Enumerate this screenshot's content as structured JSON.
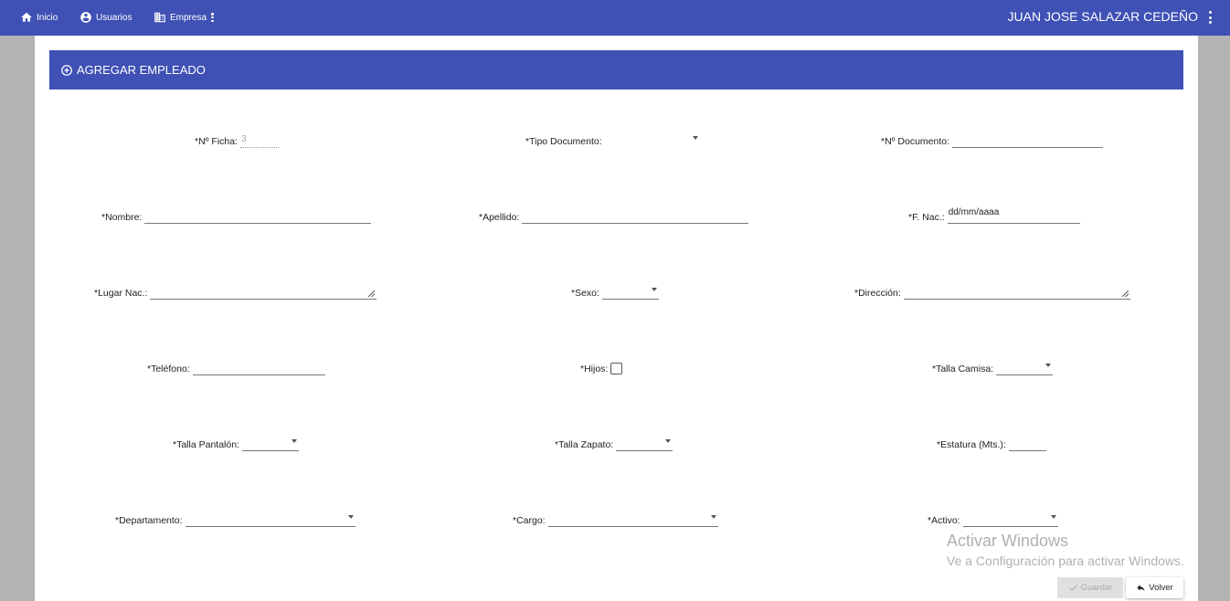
{
  "nav": {
    "home": "Inicio",
    "users": "Usuarios",
    "company": "Empresa",
    "user_name": "JUAN JOSE SALAZAR CEDEÑO"
  },
  "form": {
    "title": "AGREGAR EMPLEADO",
    "fields": {
      "ficha_label": "*Nº Ficha:",
      "ficha_value": "3",
      "tipo_doc_label": "*Tipo Documento:",
      "num_doc_label": "*Nº Documento:",
      "nombre_label": "*Nombre:",
      "apellido_label": "*Apellido:",
      "fnac_label": "*F. Nac.:",
      "fnac_value": "dd/mm/aaaa",
      "lugar_label": "*Lugar Nac.:",
      "sexo_label": "*Sexo:",
      "direccion_label": "*Dirección:",
      "telefono_label": "*Teléfono:",
      "hijos_label": "*Hijos:",
      "talla_camisa_label": "*Talla Camisa:",
      "talla_pantalon_label": "*Talla Pantalón:",
      "talla_zapato_label": "*Talla Zapato:",
      "estatura_label": "*Estatura (Mts.):",
      "departamento_label": "*Departamento:",
      "cargo_label": "*Cargo:",
      "activo_label": "*Activo:"
    },
    "hijos_checked": false
  },
  "watermark": {
    "line1": "Activar Windows",
    "line2": "Ve a Configuración para activar Windows."
  },
  "buttons": {
    "save": "Guardar",
    "back": "Volver"
  },
  "colors": {
    "primary": "#3f51b5",
    "background": "#b3b3b3"
  }
}
